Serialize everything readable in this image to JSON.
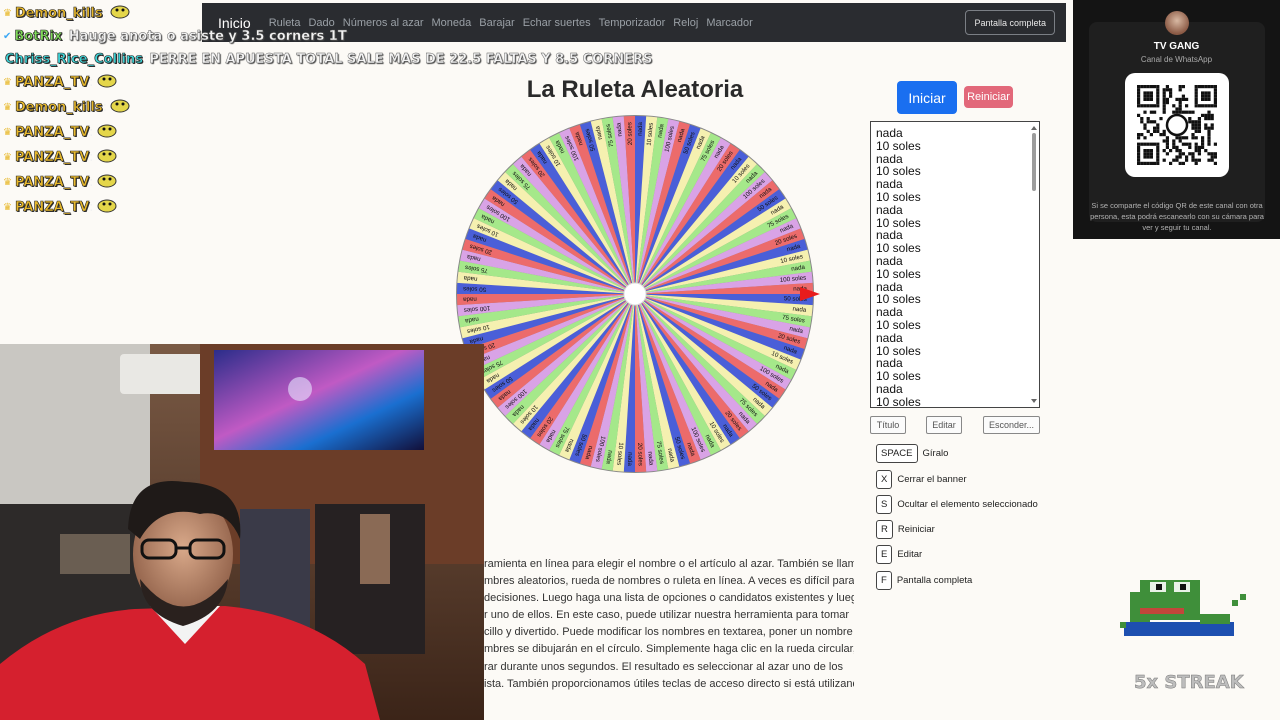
{
  "navbar": {
    "brand": "Inicio",
    "links": [
      "Ruleta",
      "Dado",
      "Números al azar",
      "Moneda",
      "Barajar",
      "Echar suertes",
      "Temporizador",
      "Reloj",
      "Marcador"
    ],
    "fullscreen_label": "Pantalla completa"
  },
  "chat": {
    "lines": [
      {
        "user": "Demon_kills",
        "msg": "",
        "user_color": "#e8b92d"
      },
      {
        "user": "BotRix",
        "msg": "Hauge anota o asiste y 3.5 corners 1T",
        "user_color": "#7ed957"
      },
      {
        "user": "Chriss_Rice_Collins",
        "msg": "PERRE EN APUESTA TOTAL SALE MAS DE 22.5 FALTAS Y 8.5 CORNERS",
        "user_color": "#3fd3d6"
      },
      {
        "user": "PANZA_TV",
        "msg": "",
        "user_color": "#e8b92d"
      },
      {
        "user": "Demon_kills",
        "msg": "",
        "user_color": "#e8b92d"
      },
      {
        "user": "PANZA_TV",
        "msg": "",
        "user_color": "#e8b92d"
      },
      {
        "user": "PANZA_TV",
        "msg": "",
        "user_color": "#e8b92d"
      },
      {
        "user": "PANZA_TV",
        "msg": "",
        "user_color": "#e8b92d"
      },
      {
        "user": "PANZA_TV",
        "msg": "",
        "user_color": "#e8b92d"
      }
    ]
  },
  "page": {
    "title": "La Ruleta Aleatoria"
  },
  "wheel": {
    "segment_labels": [
      "nada",
      "10 soles",
      "nada",
      "100 soles",
      "nada",
      "50 soles",
      "nada",
      "75 soles",
      "nada",
      "20 soles"
    ],
    "colors": [
      "#4a5fd8",
      "#f5f0b0",
      "#a5e88a",
      "#d9a3e6",
      "#ec6b6b"
    ]
  },
  "controls": {
    "start_label": "Iniciar",
    "reset_label": "Reiniciar",
    "options": [
      "nada",
      "10 soles",
      "nada",
      "10 soles",
      "nada",
      "10 soles",
      "nada",
      "10 soles",
      "nada",
      "10 soles",
      "nada",
      "10 soles",
      "nada",
      "10 soles",
      "nada",
      "10 soles",
      "nada",
      "10 soles",
      "nada",
      "10 soles",
      "nada",
      "10 soles"
    ],
    "title_btn": "Título",
    "edit_btn": "Editar",
    "hide_btn": "Esconder...",
    "shortcuts": [
      {
        "key": "SPACE",
        "label": "Gíralo"
      },
      {
        "key": "X",
        "label": "Cerrar el banner"
      },
      {
        "key": "S",
        "label": "Ocultar el elemento seleccionado"
      },
      {
        "key": "R",
        "label": "Reiniciar"
      },
      {
        "key": "E",
        "label": "Editar"
      },
      {
        "key": "F",
        "label": "Pantalla completa"
      }
    ]
  },
  "description": {
    "lines": [
      "ramienta en línea para elegir el nombre o el artículo al azar. También se llama",
      "mbres aleatorios, rueda de nombres o ruleta en línea. A veces es difícil para las",
      "decisiones. Luego haga una lista de opciones o candidatos existentes y luego",
      "r uno de ellos. En este caso, puede utilizar nuestra herramienta para tomar",
      "cillo y divertido. Puede modificar los nombres en textarea, poner un nombre",
      "mbres se dibujarán en el círculo. Simplemente haga clic en la rueda circular,",
      "rar durante unos segundos. El resultado es seleccionar al azar uno de los",
      "ista. También proporcionamos útiles teclas de acceso directo si está utilizando"
    ]
  },
  "whatsapp": {
    "name": "TV GANG",
    "subtitle": "Canal de WhatsApp",
    "note": "Si se comparte el código QR de este canal con otra persona, esta podrá escanearlo con su cámara para ver y seguir tu canal."
  },
  "overlay": {
    "streak": "5x STREAK"
  }
}
